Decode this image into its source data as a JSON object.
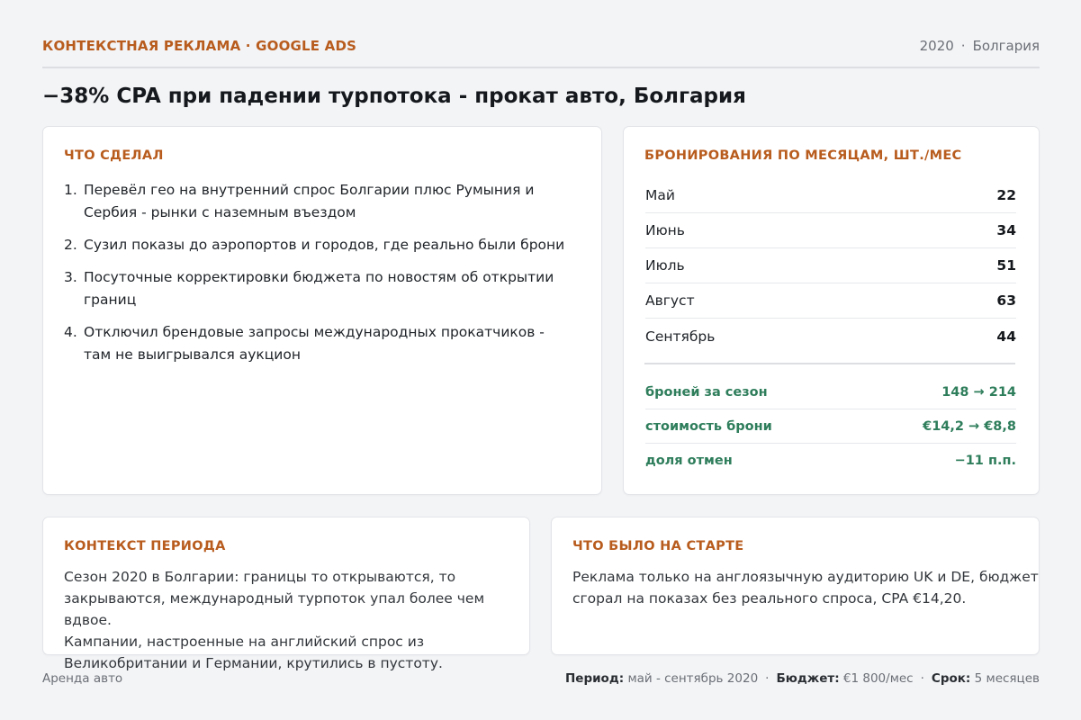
{
  "header": {
    "kicker": "КОНТЕКСТНАЯ РЕКЛАМА · GOOGLE ADS",
    "year": "2020",
    "separator": "·",
    "country": "Болгария"
  },
  "title": "−38% CPA при падении турпотока - прокат авто, Болгария",
  "actions": {
    "title": "ЧТО СДЕЛАЛ",
    "items": [
      {
        "num": "1.",
        "text": "Перевёл гео на внутренний спрос Болгарии плюс Румыния и Сербия - рынки с наземным въездом"
      },
      {
        "num": "2.",
        "text": "Сузил показы до аэропортов и городов, где реально были брони"
      },
      {
        "num": "3.",
        "text": "Посуточные корректировки бюджета по новостям об открытии границ"
      },
      {
        "num": "4.",
        "text": "Отключил брендовые запросы международных прокатчиков - там не выигрывался аукцион"
      }
    ]
  },
  "bookings": {
    "title": "БРОНИРОВАНИЯ ПО МЕСЯЦАМ, ШТ./МЕС",
    "months": [
      {
        "label": "Май",
        "value": "22"
      },
      {
        "label": "Июнь",
        "value": "34"
      },
      {
        "label": "Июль",
        "value": "51"
      },
      {
        "label": "Август",
        "value": "63"
      },
      {
        "label": "Сентябрь",
        "value": "44"
      }
    ],
    "kpis": [
      {
        "label": "броней за сезон",
        "value": "148 → 214"
      },
      {
        "label": "стоимость брони",
        "value": "€14,2 → €8,8"
      },
      {
        "label": "доля отмен",
        "value": "−11 п.п."
      }
    ]
  },
  "context": {
    "title": "КОНТЕКСТ ПЕРИОДА",
    "lines": [
      "Сезон 2020 в Болгарии: границы то открываются, то",
      "закрываются, международный турпоток упал более чем вдвое.",
      "Кампании, настроенные на английский спрос из",
      "Великобритании и Германии, крутились в пустоту."
    ]
  },
  "start": {
    "title": "ЧТО БЫЛО НА СТАРТЕ",
    "lines": [
      "Реклама только на англоязычную аудиторию UK и DE, бюджет",
      "сгорал на показах без реального спроса, CPA €14,20."
    ]
  },
  "footer": {
    "niche": "Аренда авто",
    "period_label": "Период:",
    "period_value": "май - сентябрь 2020",
    "budget_label": "Бюджет:",
    "budget_value": "€1 800/мес",
    "term_label": "Срок:",
    "term_value": "5 месяцев",
    "separator": "·"
  }
}
